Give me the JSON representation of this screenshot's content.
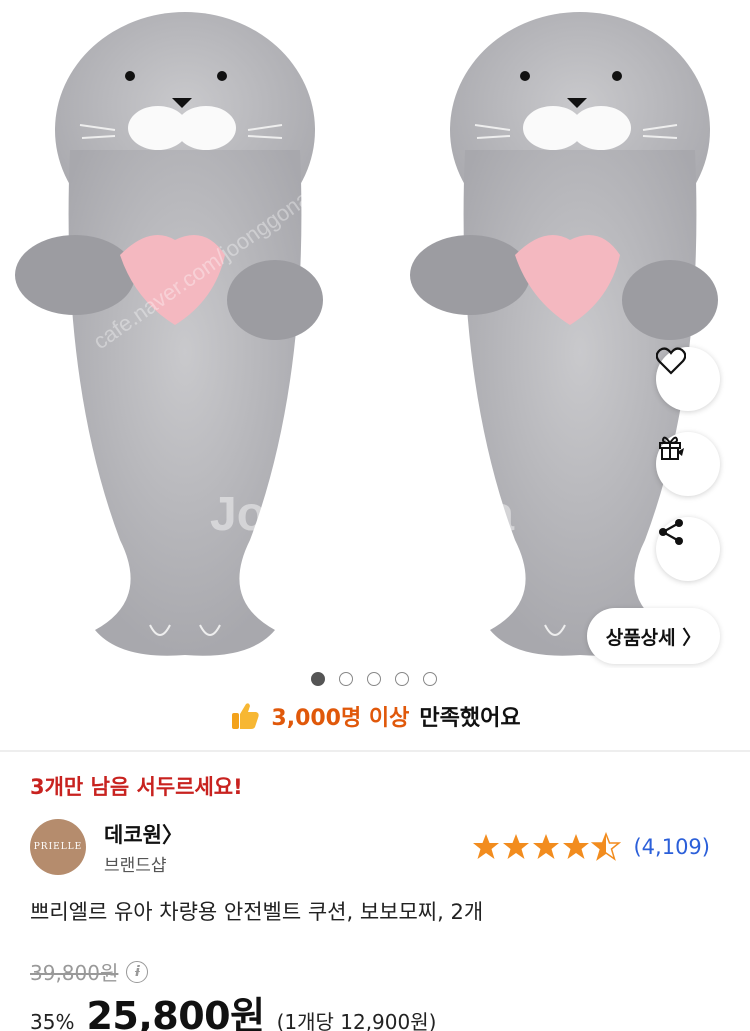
{
  "gallery": {
    "pages": 5,
    "active_index": 0,
    "watermark": "Joonggonara",
    "watermark_url": "cafe.naver.com/joonggonara",
    "detail_button_label": "상품상세 〉"
  },
  "satisfaction": {
    "highlight": "3,000명 이상",
    "rest": "만족했어요"
  },
  "stock_warning": "3개만 남음 서두르세요!",
  "seller": {
    "logo_text": "PRIELLE",
    "name": "데코원〉",
    "type": "브랜드샵"
  },
  "rating": {
    "stars": 4.5,
    "count": "(4,109)",
    "color": "#f28c1e"
  },
  "product": {
    "title": "쁘리엘르 유아 차량용 안전벨트 쿠션, 보보모찌, 2개",
    "original_price": "39,800원",
    "discount": "35%",
    "sale_price": "25,800원",
    "unit_price": "(1개당 12,900원)"
  }
}
